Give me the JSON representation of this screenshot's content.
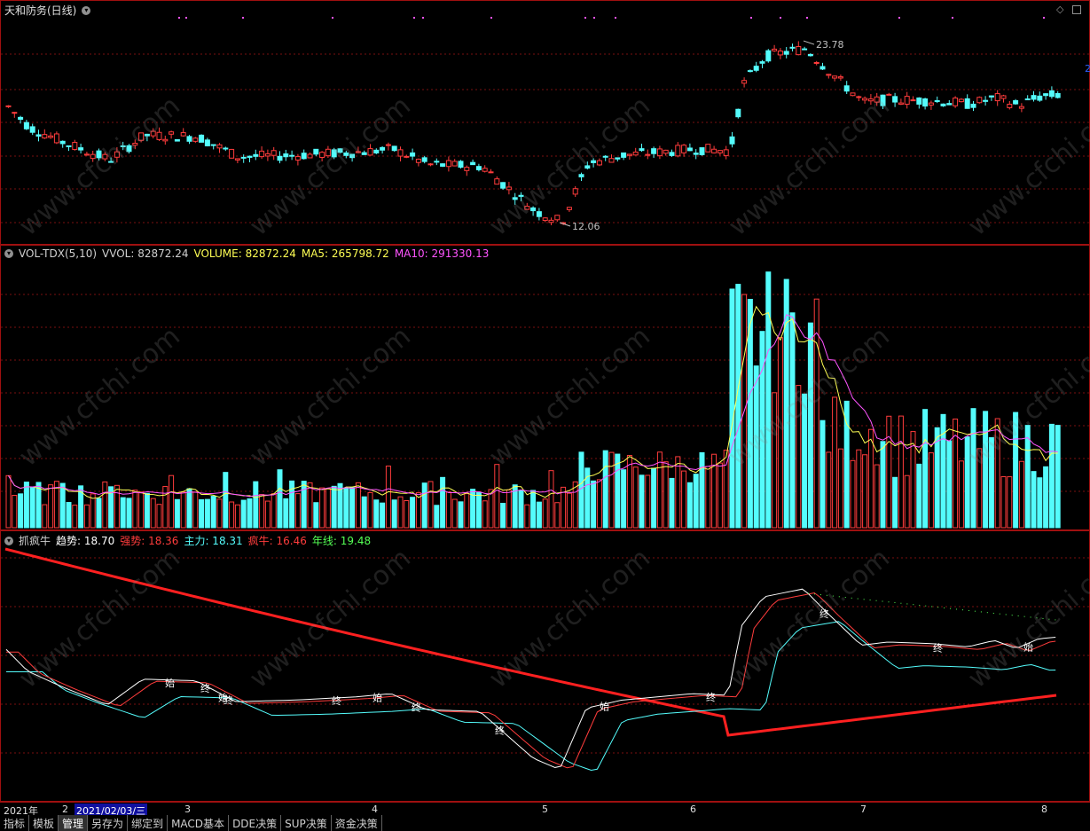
{
  "price_pane": {
    "title": "天和防务(日线)",
    "high_label": "23.78",
    "low_label": "12.06",
    "right_tag": "2",
    "high_value": 23.78,
    "low_value": 12.06
  },
  "volume_pane": {
    "name": "VOL-TDX(5,10)",
    "vvol": "VVOL: 82872.24",
    "volume": "VOLUME: 82872.24",
    "ma5": "MA5: 265798.72",
    "ma10": "MA10: 291330.13"
  },
  "indicator_pane": {
    "name": "抓疯牛",
    "trend": "趋势: 18.70",
    "strong": "强势: 18.36",
    "main": "主力: 18.31",
    "bull": "疯牛: 16.46",
    "year": "年线: 19.48",
    "marker_start": "始",
    "marker_end": "终"
  },
  "date_bar": {
    "year": "2021年",
    "m2": "2",
    "cursor_date": "2021/02/03/三",
    "m3": "3",
    "m4": "4",
    "m5": "5",
    "m6": "6",
    "m7": "7",
    "m8": "8"
  },
  "tabs": [
    "指标",
    "模板",
    "管理",
    "另存为",
    "绑定到",
    "MACD基本",
    "DDE决策",
    "SUP决策",
    "资金决策"
  ],
  "watermark": "www.cfchi.com",
  "colors": {
    "up": "#ff3c3c",
    "down": "#54fcfc",
    "ma5": "#ffff54",
    "ma10": "#ff54ff",
    "trend": "#ffffff",
    "strong": "#ff3c3c",
    "main": "#54fcfc",
    "year": "#ff2020",
    "grid": "#7a1010"
  }
}
